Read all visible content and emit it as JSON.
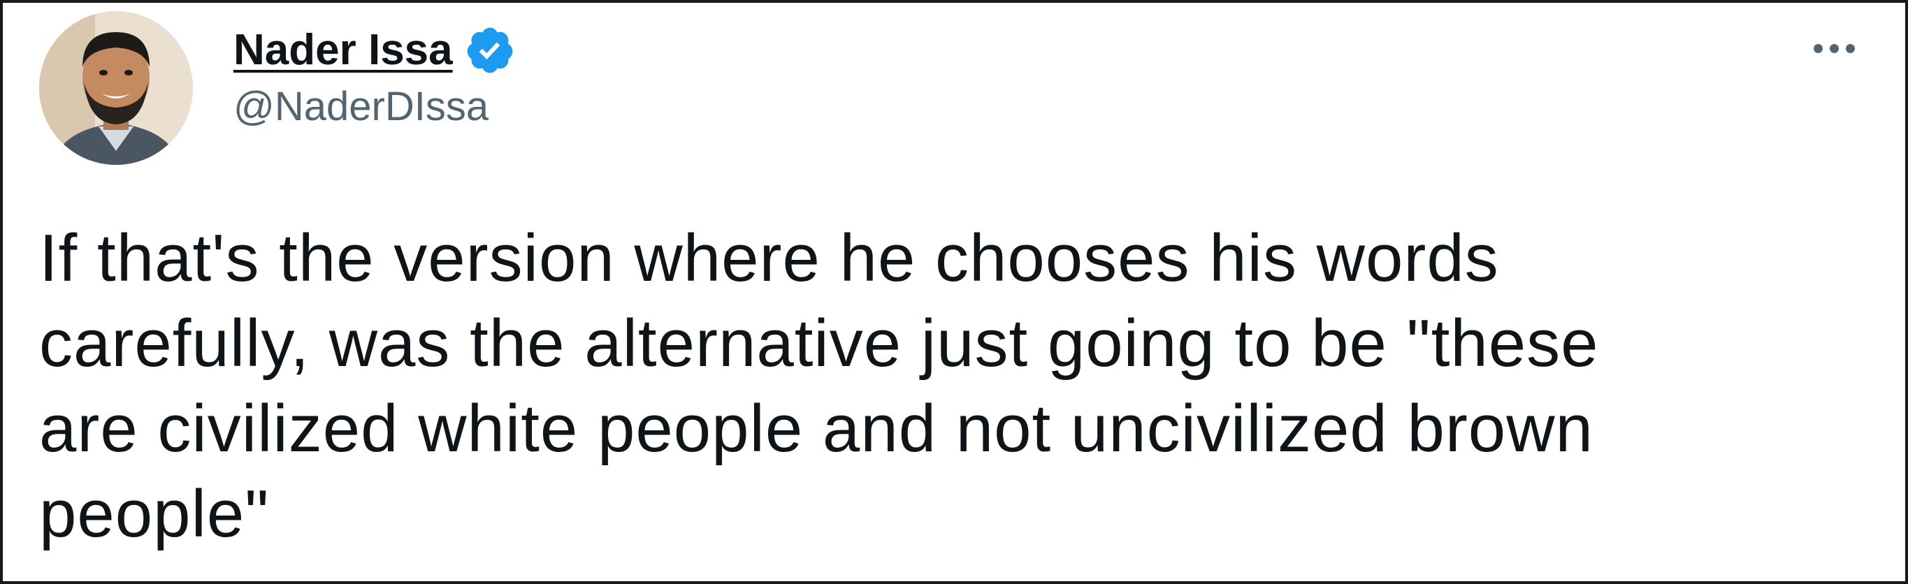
{
  "tweet": {
    "author": {
      "display_name": "Nader Issa",
      "handle": "@NaderDIssa",
      "verified": true,
      "verified_color": "#1d9bf0"
    },
    "more_icon": "more-horizontal-icon",
    "text_lines": [
      "If that's the version where he chooses his words",
      "carefully, was the alternative just going to be \"these",
      "are civilized white people and not uncivilized brown",
      "people\""
    ]
  }
}
